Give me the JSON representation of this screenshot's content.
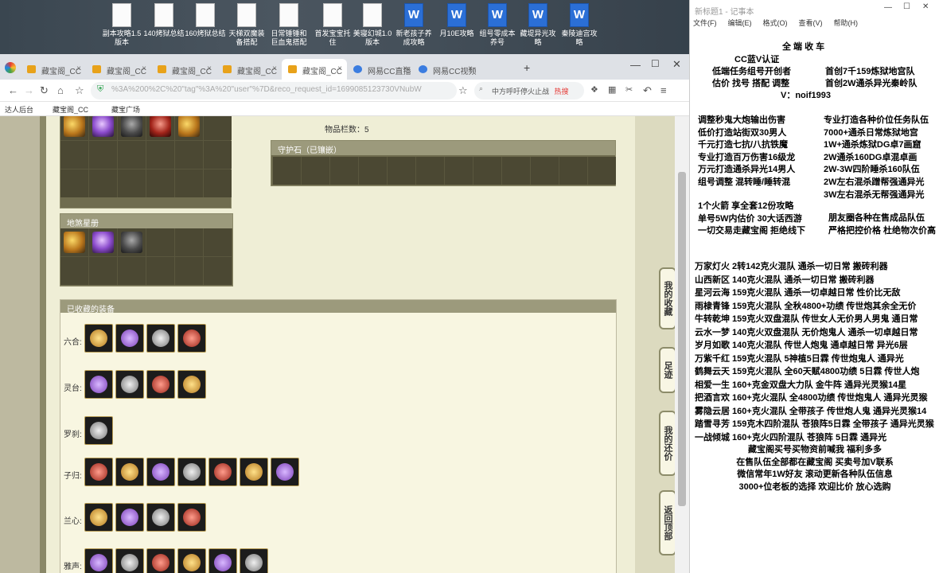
{
  "desktop": {
    "icons": [
      {
        "label": "副本攻略1.5 版本",
        "type": "doc"
      },
      {
        "label": "140烤狱总结",
        "type": "doc"
      },
      {
        "label": "160烤狱总结",
        "type": "doc"
      },
      {
        "label": "天梯双魔装 备搭配",
        "type": "doc"
      },
      {
        "label": "日常锤锤和 巨血鬼搭配",
        "type": "doc"
      },
      {
        "label": "首发宝宝托 住",
        "type": "doc"
      },
      {
        "label": "美寝幻城1.0 版本",
        "type": "doc"
      },
      {
        "label": "新老孩子养 成攻略",
        "type": "word"
      },
      {
        "label": "月10E攻略",
        "type": "word"
      },
      {
        "label": "组号零成本 养号",
        "type": "word"
      },
      {
        "label": "藏堤异光攻 略",
        "type": "word"
      },
      {
        "label": "秦陵迪宫攻 略",
        "type": "word"
      }
    ]
  },
  "browser": {
    "tabs": [
      "藏宝阁_CC",
      "藏宝阁_CC",
      "藏宝阁_CC",
      "藏宝阁_CC",
      "藏宝阁_CC",
      "网易CC直播",
      "网易CC视频"
    ],
    "url": "%3A%200%2C%20\"tag\"%3A%20\"user\"%7D&reco_request_id=1699085123730VNubW",
    "search_text": "中方呼吁停火止战",
    "search_badge": "热搜",
    "bookmarks": [
      "达人后台",
      "藏宝阁_CC",
      "藏宝广场"
    ]
  },
  "game": {
    "item_count_label": "物品栏数：5",
    "guardian_stone_label": "守护石（已镶嵌）",
    "ground_label": "地煞星册",
    "collected_label": "已收藏的装备",
    "categories": [
      {
        "name": "六合:",
        "count": 4
      },
      {
        "name": "灵台:",
        "count": 4
      },
      {
        "name": "罗刹:",
        "count": 1
      },
      {
        "name": "子归:",
        "count": 7
      },
      {
        "name": "兰心:",
        "count": 4
      },
      {
        "name": "雅声:",
        "count": 6
      }
    ],
    "side_buttons": [
      "我的收藏",
      "足迹",
      "我的还价",
      "返回顶部"
    ]
  },
  "notepad": {
    "title": "新标题1 - 记事本",
    "menu": [
      "文件(F)",
      "编辑(E)",
      "格式(O)",
      "查看(V)",
      "帮助(H)"
    ],
    "header_lines": [
      "全 端 收 车",
      "CC蓝V认证 ",
      ""
    ],
    "promo_left": [
      "低端任务组号开创者",
      "估价 找号 搭配 调整"
    ],
    "promo_right": [
      "首创7千159炼狱地宫队",
      "首创2W通杀异光秦岭队"
    ],
    "contact": "V：noif1993",
    "service_left": [
      "调整秒鬼大炮输出伤害",
      "低价打造站街双30男人",
      "千元打造七抗/八抗铁魔",
      "专业打造百万伤害16级龙",
      "万元打造通杀异光14男人",
      "组号调整 混转睡/睡转混"
    ],
    "service_right": [
      "专业打造各种价位任务队伍",
      "7000+通杀日常炼狱地宫",
      "1W+通杀炼狱DG卓7画窟",
      "2W通杀160DG卓混卓画",
      "2W-3W四阶睡杀160队伍",
      "2W左右混杀蹭帮强通异光",
      "3W左右混杀无帮强通异光"
    ],
    "misc_left": [
      "1个火箭 享全套12份攻略",
      "单号5W内估价 30大话西游",
      "一切交易走藏宝阁 拒绝线下"
    ],
    "misc_right": [
      "朋友圈各种在售成品队伍",
      "严格把控价格 杜绝物次价高"
    ],
    "teams": [
      "万家灯火 2转142克火混队 通杀一切日常 搬砖利器",
      "山西新区 140克火混队 通杀一切日常 搬砖利器",
      "星河云海 159克火混队 通杀一切卓越日常 性价比无敌",
      "雨棣青锋 159克火混队 全秋4800+功绩 传世炮其余全无价",
      "牛转乾坤 159克火双盘混队 传世女人无价男人男鬼 通日常",
      "云水一梦 140克火双盘混队 无价炮鬼人 通杀一切卓越日常",
      "岁月如歌 140克火混队 传世人炮鬼 通卓越日常 异光6层",
      "万紫千红 159克火混队 5神植5日霖 传世炮鬼人 通异光",
      "鹤舞云天 159克火混队 全60天赋4800功绩 5日霖 传世人炮",
      "相爱一生 160+克金双盘大力队 金牛阵 通异光灵猴14星",
      "把酒言欢 160+克火混队 全4800功绩 传世炮鬼人 通异光灵猴",
      "雾隐云居 160+克火混队 全带孩子 传世炮人鬼 通异光灵猴14",
      "踏雪寻芳 159克木四阶混队 苍狼阵5日霖 全带孩子 通异光灵猴",
      "一战倾城 160+克火四阶混队 苍狼阵 5日霖 通异光"
    ],
    "footer": [
      "藏宝阁买号买物资前喊我 福利多多",
      "在售队伍全部都在藏宝阁 买卖号加V联系",
      "微信常年1W好友 滚动更新各种队伍信息",
      "3000+位老板的选择 欢迎比价 放心选购"
    ]
  }
}
